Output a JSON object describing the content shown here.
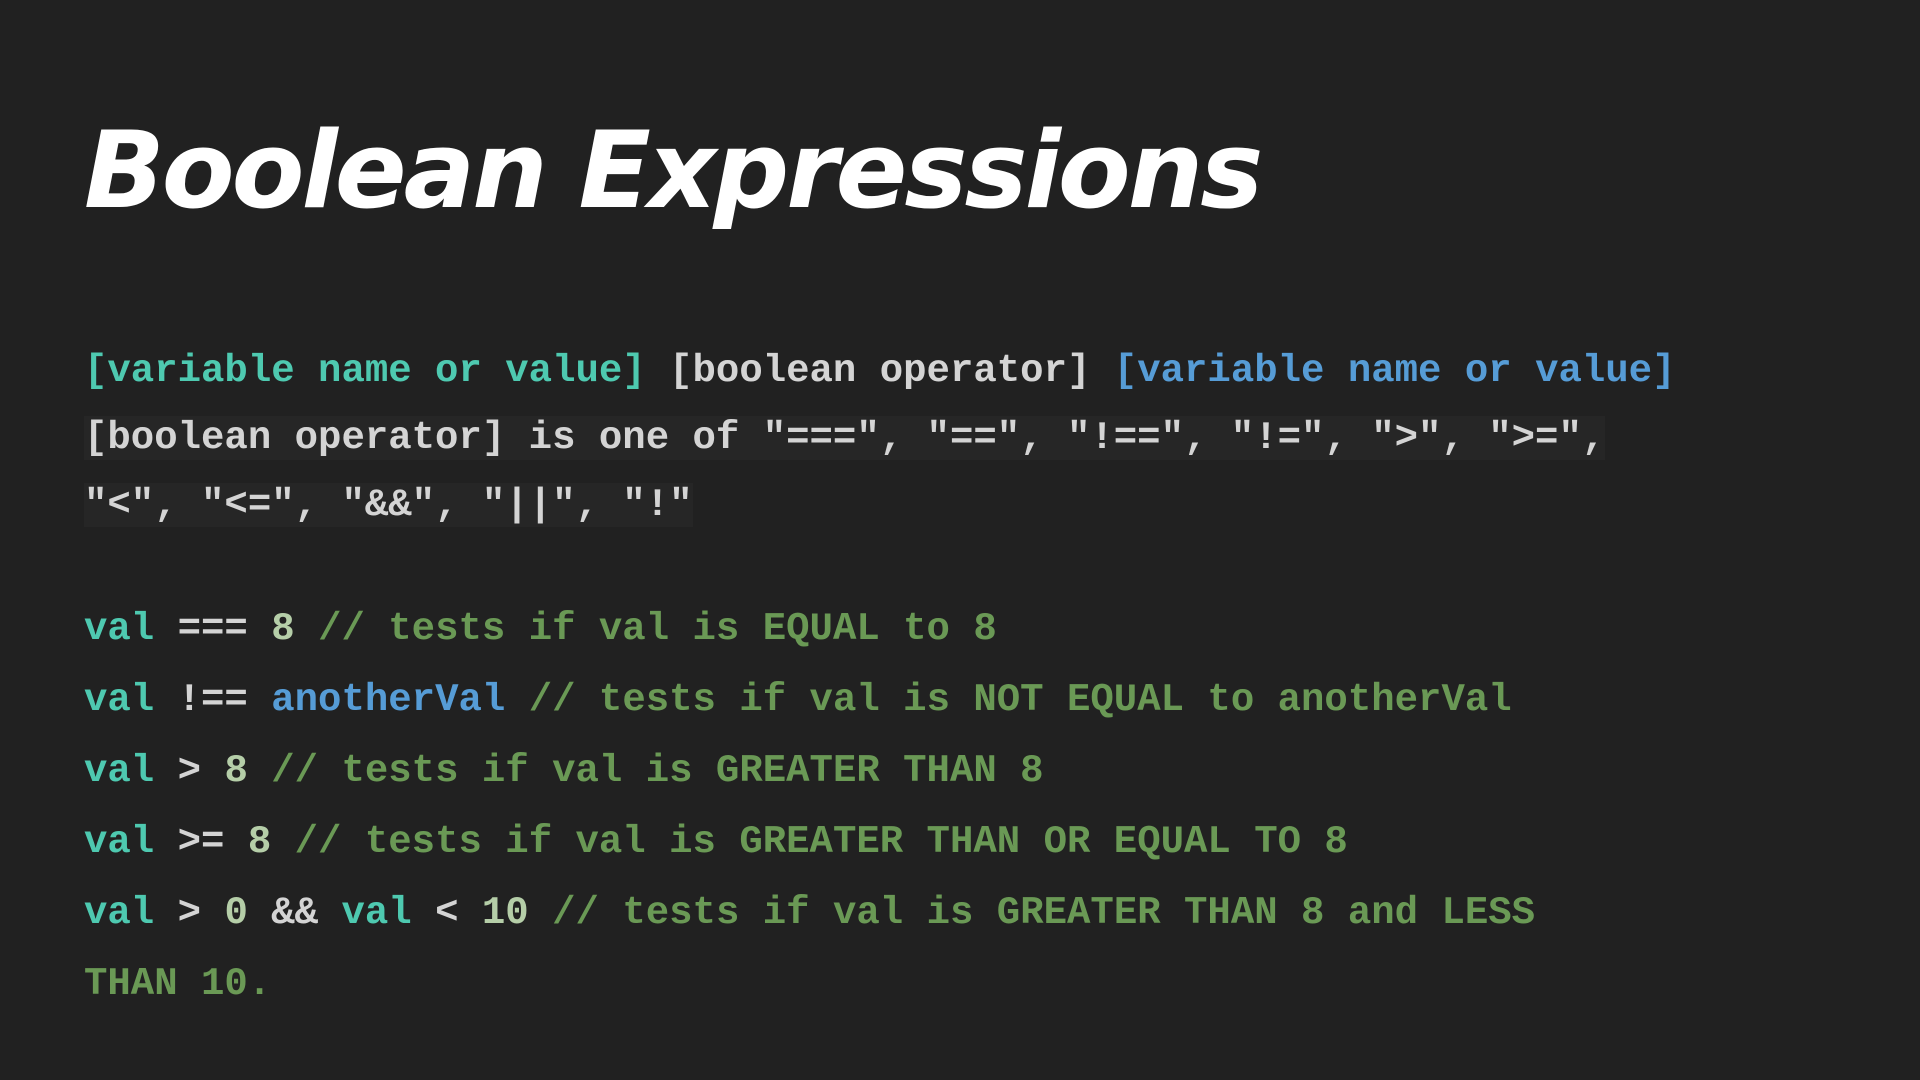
{
  "title": "Boolean Expressions",
  "syntax": {
    "left_operand": "[variable name or value]",
    "operator": "[boolean operator]",
    "right_operand": "[variable name or value]",
    "desc_line1": "[boolean operator] is one of \"===\", \"==\", \"!==\", \"!=\", \">\", \">=\",",
    "desc_line2": "\"<\", \"<=\", \"&&\", \"||\", \"!\""
  },
  "examples": [
    {
      "var": "val",
      "op": "===",
      "rhs": "8",
      "comment": "// tests if val is EQUAL to 8"
    },
    {
      "var": "val",
      "op": "!==",
      "rhs": "anotherVal",
      "comment": "// tests if val is NOT EQUAL to anotherVal"
    },
    {
      "var": "val",
      "op": ">",
      "rhs": "8",
      "comment": "// tests if val is GREATER THAN 8"
    },
    {
      "var": "val",
      "op": ">=",
      "rhs": "8",
      "comment": "// tests if val is GREATER THAN OR EQUAL TO 8"
    }
  ],
  "compound": {
    "var1": "val",
    "op1": ">",
    "num1": "0",
    "logic": "&&",
    "var2": "val",
    "op2": "<",
    "num2": "10",
    "comment_line1": "// tests if val is GREATER THAN 8 and LESS",
    "comment_line2": "THAN 10."
  },
  "colors": {
    "background": "#212121",
    "title": "#ffffff",
    "identifier": "#4ec9b0",
    "operator": "#d4d4d4",
    "variable_blue": "#569cd6",
    "comment": "#6a9955",
    "number": "#b5cea8"
  }
}
